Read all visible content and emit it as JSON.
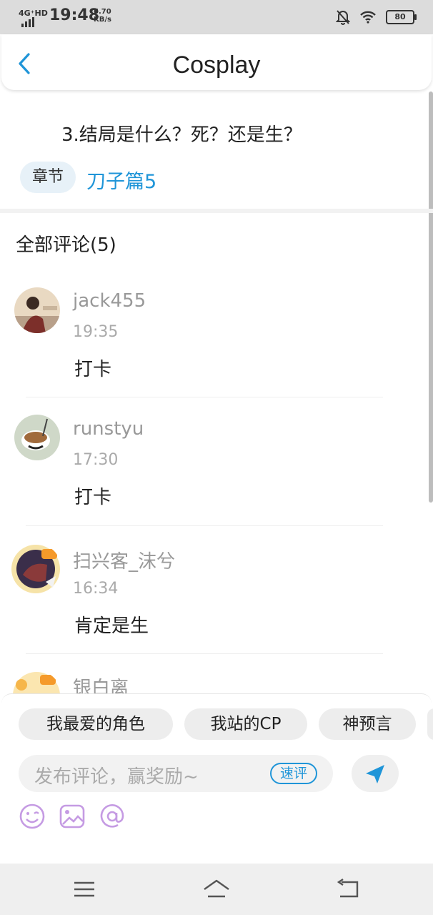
{
  "status_bar": {
    "network": "4G⁺HD",
    "time": "19:48",
    "speed_value": "6.70",
    "speed_unit": "KB/s",
    "battery": "80",
    "icons": [
      "signal-icon",
      "mute-bell-icon",
      "wifi-icon",
      "battery-icon"
    ]
  },
  "header": {
    "title": "Cosplay",
    "back_icon": "chevron-left-icon",
    "accent_color": "#1f95d8"
  },
  "chapter": {
    "text": "3.结局是什么？死？还是生？",
    "tag_label": "章节",
    "link_label": "刀子篇5"
  },
  "comments": {
    "title": "全部评论(5)",
    "items": [
      {
        "name": "jack455",
        "time": "19:35",
        "text": "打卡"
      },
      {
        "name": "runstyu",
        "time": "17:30",
        "text": "打卡"
      },
      {
        "name": "扫兴客_沫兮",
        "time": "16:34",
        "text": "肯定是生"
      },
      {
        "name": "银白离",
        "time": "",
        "text": ""
      }
    ]
  },
  "quick_tags": [
    "我最爱的角色",
    "我站的CP",
    "神预言"
  ],
  "input": {
    "placeholder": "发布评论，赢奖励~",
    "quick_button": "速评"
  },
  "tools": [
    "emoji-icon",
    "image-icon",
    "at-icon"
  ],
  "nav": [
    "menu-icon",
    "home-icon",
    "back-icon"
  ]
}
